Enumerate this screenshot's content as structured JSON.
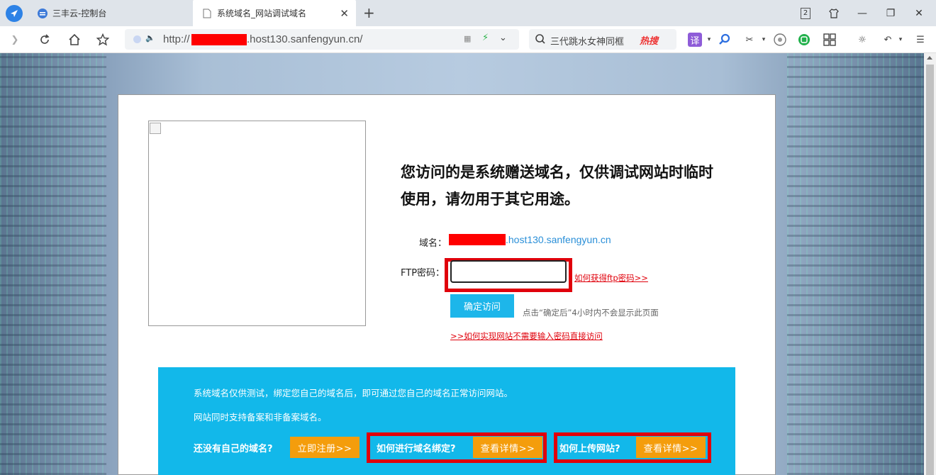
{
  "browser": {
    "tabs": [
      {
        "label": "三丰云-控制台",
        "icon": "cloud-console-icon",
        "active": false
      },
      {
        "label": "系统域名_网站调试域名",
        "icon": "page-icon",
        "active": true
      }
    ],
    "tab_count_badge": "2",
    "address": {
      "url_prefix": "http://",
      "url_suffix": ".host130.sanfengyun.cn/"
    },
    "search": {
      "text": "三代跳水女神同框",
      "hot_label": "热搜"
    },
    "colors": {
      "accent": "#2d82e6",
      "hot": "#e33333"
    }
  },
  "page": {
    "headline": "您访问的是系统赠送域名，仅供调试网站时临时使用，请勿用于其它用途。",
    "domain_label": "域名：",
    "domain_value": ".host130.sanfengyun.cn",
    "ftp_label": "FTP密码：",
    "ftp_placeholder": "",
    "ftp_help_link": "如何获得ftp密码>>",
    "confirm_button": "确定访问",
    "confirm_hint": "点击“确定后”4小时内不会显示此页面",
    "nopw_link": ">>如何实现网站不需要输入密码直接访问",
    "promo": {
      "line1": "系统域名仅供测试，绑定您自己的域名后，即可通过您自己的域名正常访问网站。",
      "line2": "网站同时支持备案和非备案域名。",
      "q1": "还没有自己的域名?",
      "b1": "立即注册>>",
      "q2": "如何进行域名绑定?",
      "b2": "查看详情>>",
      "q3": "如何上传网站?",
      "b3": "查看详情>>"
    },
    "colors": {
      "link_red": "#e0000b",
      "button_blue": "#1db6ea",
      "promo_bg": "#12b8ea",
      "orange": "#f49d0c"
    }
  }
}
